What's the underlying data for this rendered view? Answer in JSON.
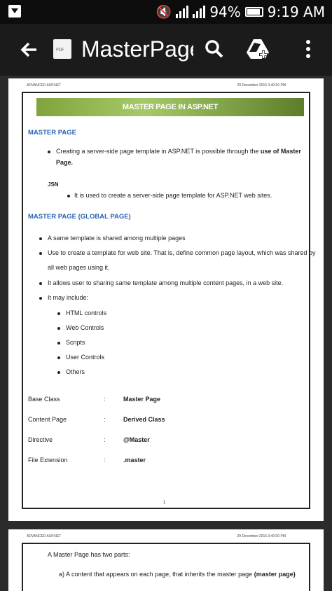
{
  "status_bar": {
    "battery": "94%",
    "time": "9:19 AM"
  },
  "app_bar": {
    "title": "MasterPage",
    "file_badge": "PDF"
  },
  "page1": {
    "header_left": "ADVANCED ASP.NET",
    "header_right": "29 December 2015 3:40:00 PM",
    "banner": "MASTER PAGE IN ASP.NET",
    "sections": [
      {
        "heading": "MASTER PAGE"
      },
      {
        "heading": "MASTER PAGE (GLOBAL PAGE)"
      }
    ],
    "intro_line1_a": "Creating a server-side page template in ASP.NET is possible through the",
    "intro_line1_b": "use of Master",
    "intro_line2": "Page.",
    "abbr": "JSN",
    "abbr_text": "It is used to create a server-side page template for ASP.NET web sites.",
    "global_bullets": [
      "A same template is shared among multiple pages",
      "Use to create a template for web site. That is, define common page layout, which was shared by",
      "all web pages using it.",
      "It allows user to sharing same template among multiple content pages, in a web site.",
      "It may include:"
    ],
    "includes": [
      "HTML controls",
      "Web Controls",
      "Scripts",
      "User Controls",
      "Others"
    ],
    "table": [
      {
        "label": "Base Class",
        "sep": ":",
        "value": "Master Page"
      },
      {
        "label": "Content Page",
        "sep": ":",
        "value": "Derived Class"
      },
      {
        "label": "Directive",
        "sep": ":",
        "value": "@Master"
      },
      {
        "label": "File Extension",
        "sep": ":",
        "value": ".master"
      }
    ],
    "page_number": "1"
  },
  "page2": {
    "header_left": "ADVANCED ASP.NET",
    "header_right": "29 December 2015 3:40:00 PM",
    "line1": "A Master Page has two parts:",
    "line2_a": "a)  A content that appears on each page, that inherits the master page",
    "line2_b": "(master page)"
  }
}
